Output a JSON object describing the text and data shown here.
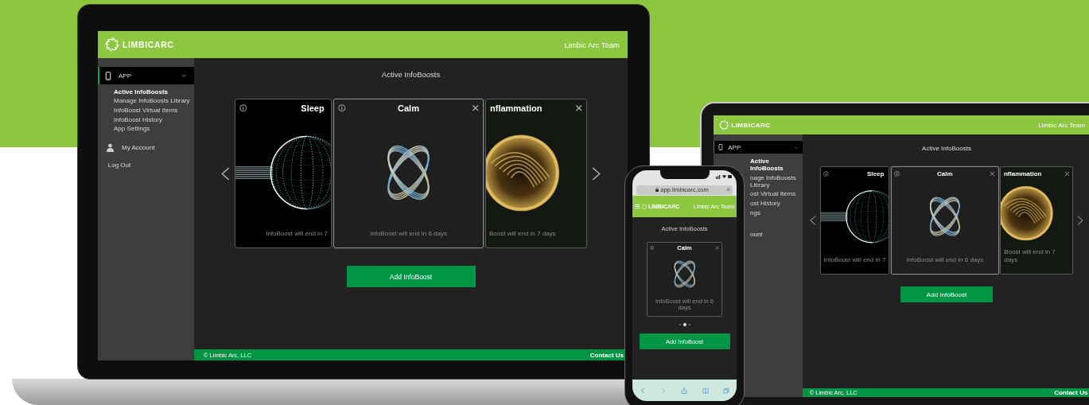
{
  "laptop": {
    "header": {
      "logo": "LIMBICARC",
      "user": "Limbic Arc Team"
    },
    "sidebar": [
      {
        "kind": "group",
        "label": "APP",
        "expanded": true,
        "children": [
          {
            "label": "Active InfoBoosts",
            "selected": true
          },
          {
            "label": "Manage InfoBoosts Library",
            "selected": false
          },
          {
            "label": "InfoBoost Virtual Items",
            "selected": false
          },
          {
            "label": "InfoBoost History",
            "selected": false
          },
          {
            "label": "App Settings",
            "selected": false
          }
        ]
      },
      {
        "kind": "account",
        "label": "My Account"
      },
      {
        "kind": "logout",
        "label": "Log Out"
      }
    ],
    "title": "Active InfoBoosts",
    "cards": [
      {
        "kind": "sphere",
        "title": "Sleep",
        "note": "InfoBoost will end in 7",
        "selected": false,
        "info": true,
        "close": false
      },
      {
        "kind": "rings",
        "title": "Calm",
        "note": "InfoBoost will end in 6 days",
        "selected": true,
        "info": true,
        "close": true
      },
      {
        "kind": "swirl",
        "title": "nflammation",
        "note": "Boost will end in 7 days",
        "selected": false,
        "info": false,
        "close": true
      }
    ],
    "button": "Add InfoBoost",
    "footer": {
      "copyright": "© Limbic Arc, LLC",
      "contact": "Contact Us"
    }
  },
  "tablet": {
    "header": {
      "logo": "LIMBICARC",
      "user": "Limbic Arc Team"
    },
    "sidebar": [
      {
        "kind": "group",
        "label": "APP",
        "expanded": true,
        "children": [
          {
            "label": "Active InfoBoosts",
            "selected": true
          },
          {
            "label": "nage InfoBoosts Library",
            "selected": false
          },
          {
            "label": "ost Virtual Items",
            "selected": false
          },
          {
            "label": "ost History",
            "selected": false
          },
          {
            "label": "ngs",
            "selected": false
          }
        ]
      },
      {
        "kind": "link",
        "label": "ount"
      }
    ],
    "title": "Active InfoBoosts",
    "cards": [
      {
        "kind": "sphere",
        "title": "Sleep",
        "note": "InfoBoost will end in 7",
        "selected": false,
        "info": true,
        "close": false
      },
      {
        "kind": "rings",
        "title": "Calm",
        "note": "InfoBoost will end in 6 days",
        "selected": true,
        "info": true,
        "close": true
      },
      {
        "kind": "swirl",
        "title": "nflammation",
        "note": "Boost will end in 7 days",
        "selected": false,
        "info": false,
        "close": true
      }
    ],
    "button": "Add InfoBoost",
    "footer": {
      "copyright": "© Limbic Arc, LLC",
      "contact": "Contact Us"
    }
  },
  "phone": {
    "url": "app.limbicarc.com",
    "header": {
      "logo": "LIMBICARC",
      "user": "Limbic Arc Team"
    },
    "title": "Active InfoBoosts",
    "card": {
      "kind": "rings",
      "title": "Calm",
      "note": "InfoBoost will end in 6 days",
      "info": true,
      "close": true
    },
    "dots": [
      {
        "selected": false
      },
      {
        "selected": true
      },
      {
        "selected": false
      }
    ],
    "button": "Add InfoBoost"
  }
}
